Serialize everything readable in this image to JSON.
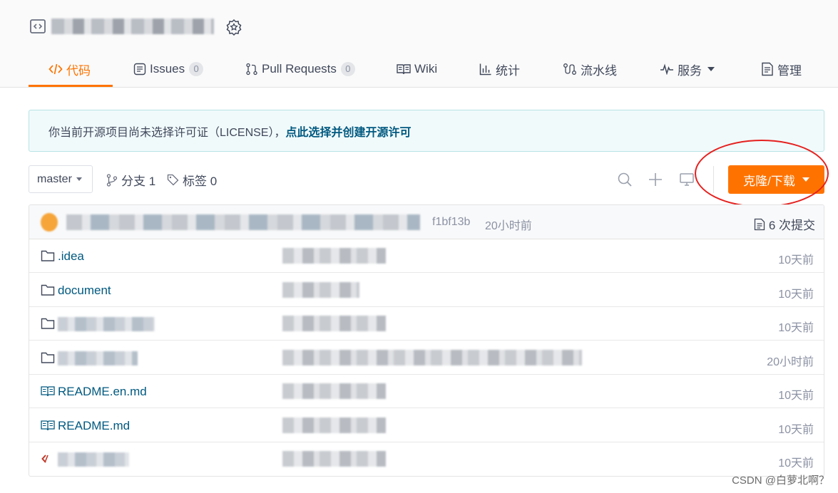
{
  "header": {
    "tabs": [
      {
        "label": "代码",
        "icon": "code-icon",
        "active": true
      },
      {
        "label": "Issues",
        "count": "0",
        "icon": "issues-icon"
      },
      {
        "label": "Pull Requests",
        "count": "0",
        "icon": "pull-request-icon"
      },
      {
        "label": "Wiki",
        "icon": "book-icon"
      },
      {
        "label": "统计",
        "icon": "bar-chart-icon"
      },
      {
        "label": "流水线",
        "icon": "pipeline-icon"
      },
      {
        "label": "服务",
        "icon": "pulse-icon"
      },
      {
        "label": "管理",
        "icon": "manage-icon"
      }
    ]
  },
  "notice": {
    "text": "你当前开源项目尚未选择许可证（LICENSE），",
    "link": "点此选择并创建开源许可"
  },
  "toolbar": {
    "branch": "master",
    "branches_label": "分支 1",
    "tags_label": "标签 0",
    "clone_label": "克隆/下载"
  },
  "commit": {
    "hash": "f1bf13b",
    "time": "20小时前",
    "count_label": "6 次提交"
  },
  "files": [
    {
      "name": ".idea",
      "type": "folder",
      "time": "10天前"
    },
    {
      "name": "document",
      "type": "folder",
      "time": "10天前"
    },
    {
      "name": "",
      "type": "folder",
      "time": "10天前"
    },
    {
      "name": "",
      "type": "folder",
      "time": "20小时前"
    },
    {
      "name": "README.en.md",
      "type": "readme",
      "time": "10天前"
    },
    {
      "name": "README.md",
      "type": "readme",
      "time": "10天前"
    },
    {
      "name": "",
      "type": "code",
      "time": "10天前"
    }
  ],
  "watermark": "CSDN @白萝北啊？",
  "colors": {
    "accent": "#fe7300",
    "link": "#005980",
    "annotation": "#e5201e"
  }
}
